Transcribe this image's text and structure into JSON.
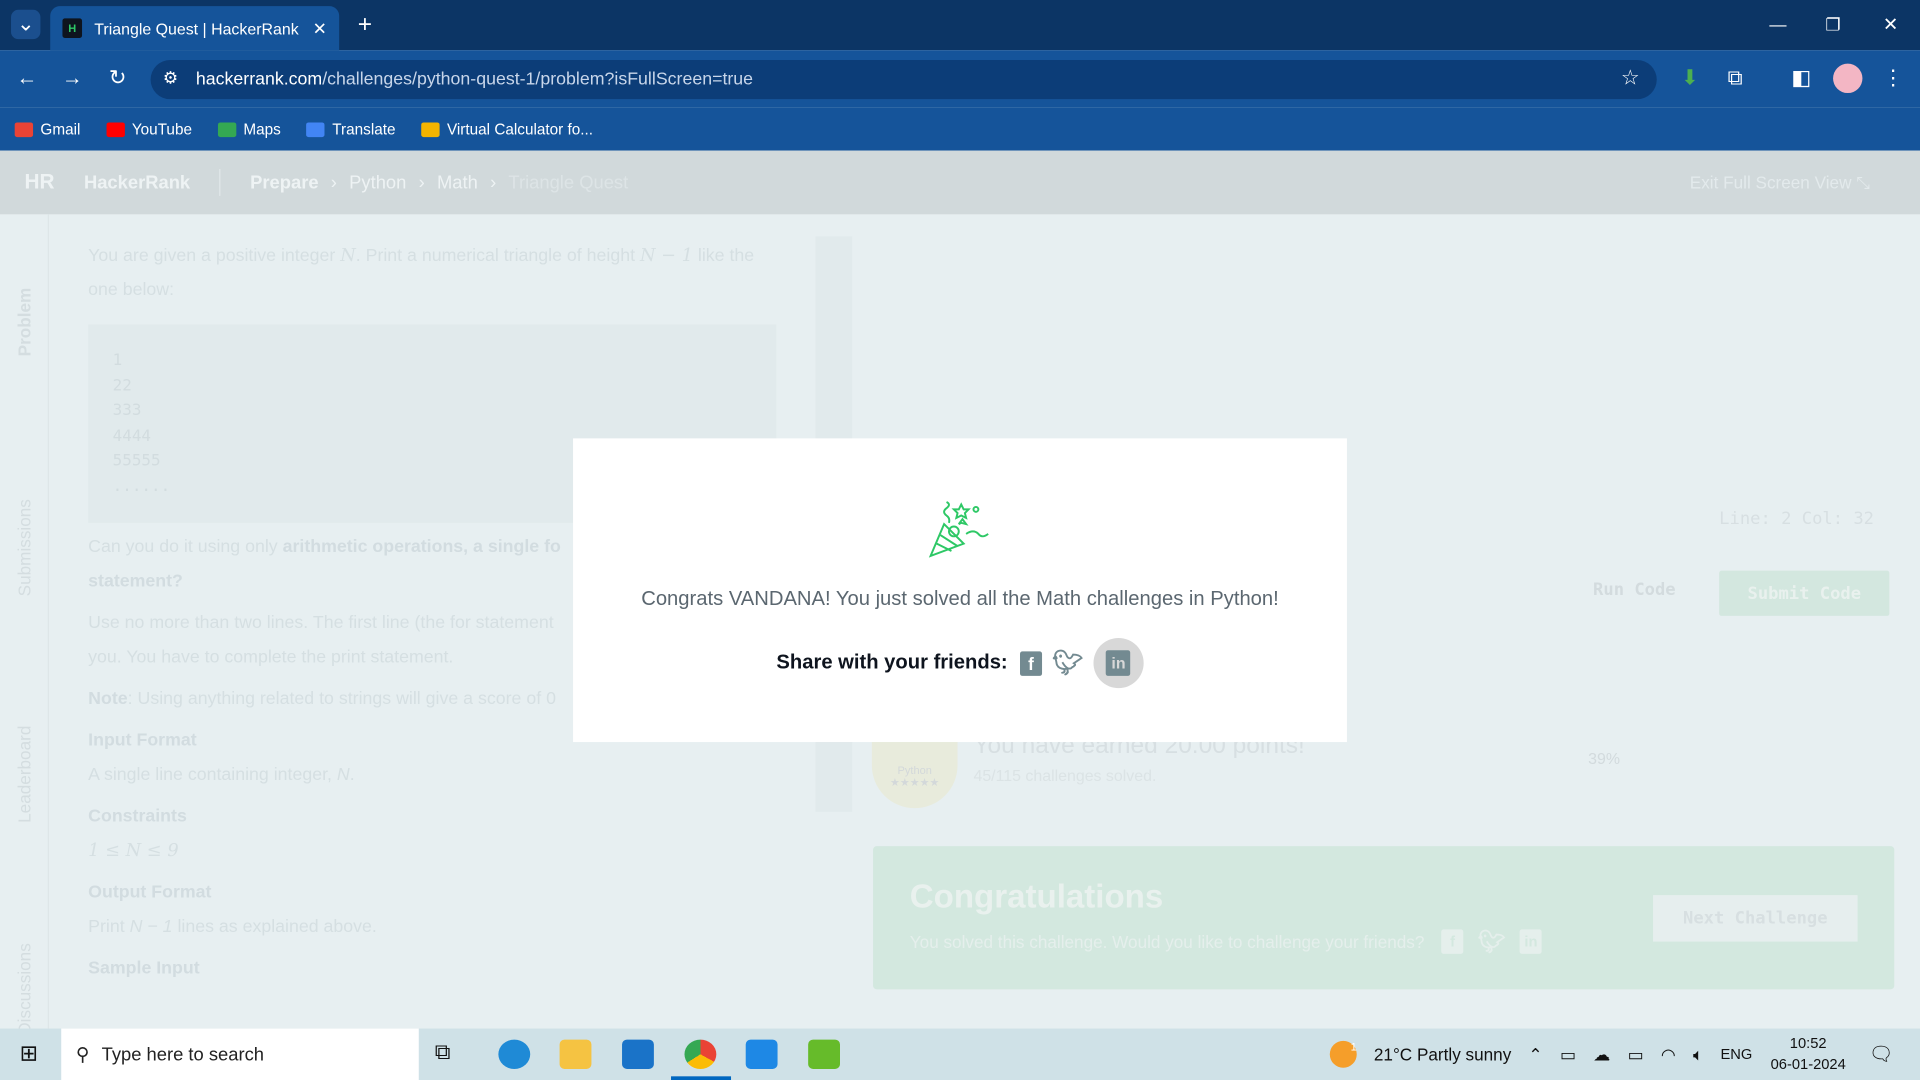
{
  "browser": {
    "tab_title": "Triangle Quest | HackerRank",
    "url_host": "hackerrank.com",
    "url_path": "/challenges/python-quest-1/problem?isFullScreen=true",
    "bookmarks": [
      {
        "label": "Gmail",
        "icon": "gmail-icon",
        "color": "#ea4335"
      },
      {
        "label": "YouTube",
        "icon": "youtube-icon",
        "color": "#ff0000"
      },
      {
        "label": "Maps",
        "icon": "maps-icon",
        "color": "#34a853"
      },
      {
        "label": "Translate",
        "icon": "translate-icon",
        "color": "#4285f4"
      },
      {
        "label": "Virtual Calculator fo...",
        "icon": "calculator-icon",
        "color": "#f4b400"
      }
    ]
  },
  "header": {
    "brand": "HackerRank",
    "logo": "HR",
    "breadcrumbs": [
      "Prepare",
      "Python",
      "Math",
      "Triangle Quest"
    ],
    "exit_fullscreen": "Exit Full Screen View"
  },
  "sidebar": {
    "tabs": [
      "Problem",
      "Submissions",
      "Leaderboard",
      "Discussions"
    ]
  },
  "problem": {
    "intro_a": "You are given a positive integer ",
    "var_n": "N",
    "intro_b": ". Print a numerical triangle of height ",
    "expr": "N − 1",
    "intro_c": " like the one below:",
    "code_lines": [
      "1",
      "22",
      "333",
      "4444",
      "55555",
      "......"
    ],
    "q_a": "Can you do it using only ",
    "q_bold": "arithmetic operations, a single fo",
    "q_bold2": "statement?",
    "use": "Use no more than two lines. The first line (the for statement",
    "use2": "you. You have to complete the print statement.",
    "note_label": "Note",
    "note": ": Using anything related to strings will give a score of ",
    "zero": "0",
    "input_h": "Input Format",
    "input": "A single line containing integer, ",
    "dot": ".",
    "constraints_h": "Constraints",
    "constraints": "1 ≤ N ≤ 9",
    "output_h": "Output Format",
    "output_a": "Print ",
    "output_b": " lines as explained above.",
    "sample_h": "Sample Input"
  },
  "editor": {
    "line_col": "Line: 2 Col: 32",
    "run": "Run Code",
    "submit": "Submit Code"
  },
  "progress": {
    "earned": "You have earned 20.00 points!",
    "solved": "45/115 challenges solved.",
    "percent_label": "39%",
    "percent": 39,
    "badge": "Python",
    "stars": "★★★★★"
  },
  "congrats_panel": {
    "title": "Congratulations",
    "text": "You solved this challenge. Would you like to challenge your friends?",
    "next": "Next Challenge"
  },
  "modal": {
    "message": "Congrats VANDANA! You just solved all the Math challenges in Python!",
    "share": "Share with your friends:",
    "accent": "#2ec866"
  },
  "taskbar": {
    "search_placeholder": "Type here to search",
    "weather": "21°C  Partly sunny",
    "weather_badge": "1",
    "lang": "ENG",
    "time": "10:52",
    "date": "06-01-2024"
  }
}
